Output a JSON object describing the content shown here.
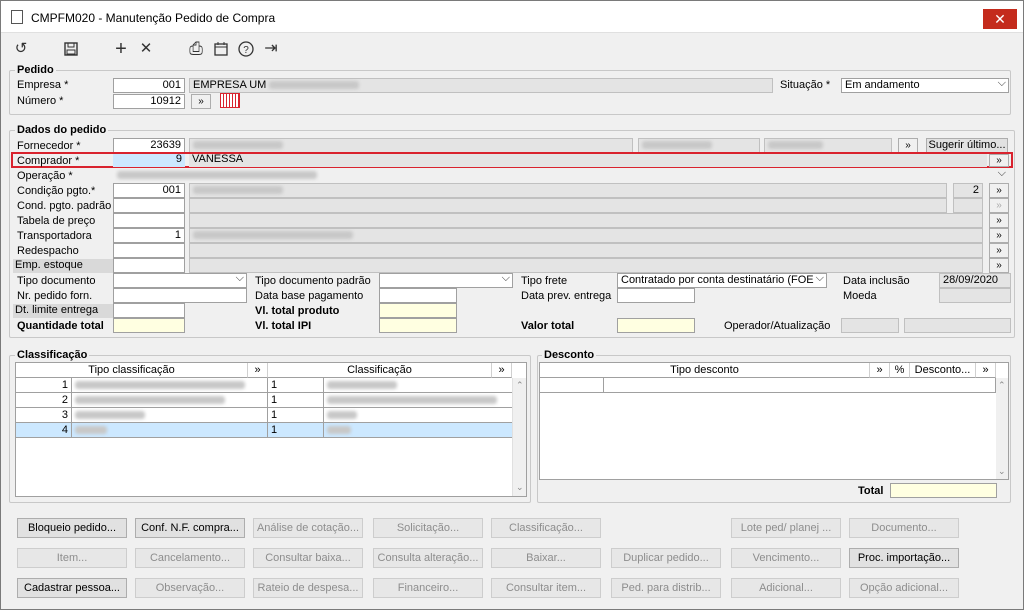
{
  "window": {
    "title": "CMPFM020 - Manutenção Pedido de Compra",
    "close": "✕"
  },
  "toolbar": {
    "undo": "↺",
    "save": "💾",
    "add": "+",
    "delete": "✕",
    "print": "⎙",
    "calendar": "📅",
    "help": "?",
    "exit": "⇥"
  },
  "pedido": {
    "title": "Pedido",
    "empresa_label": "Empresa *",
    "empresa_code": "001",
    "empresa_name": "EMPRESA UM",
    "numero_label": "Número *",
    "numero_value": "10912",
    "numero_btn": "»",
    "situacao_label": "Situação *",
    "situacao_value": "Em andamento"
  },
  "dados": {
    "title": "Dados do pedido",
    "fornecedor_label": "Fornecedor *",
    "fornecedor_code": "23639",
    "fornecedor_btn": "»",
    "sugerir": "Sugerir último...",
    "comprador_label": "Comprador *",
    "comprador_code": "9",
    "comprador_name": "VANESSA",
    "comprador_btn": "»",
    "operacao_label": "Operação *",
    "condicao_label": "Condição pgto.*",
    "condicao_code": "001",
    "condicao_num": "2",
    "condicao_btn": "»",
    "cond_padrao_label": "Cond. pgto. padrão",
    "tabela_label": "Tabela de preço",
    "tabela_btn": "»",
    "transp_label": "Transportadora",
    "transp_code": "1",
    "transp_btn": "»",
    "redesp_label": "Redespacho",
    "redesp_btn": "»",
    "emp_estoque_label": "Emp. estoque",
    "emp_estoque_btn": "»",
    "tipo_doc_label": "Tipo documento",
    "tipo_doc_padrao_label": "Tipo documento padrão",
    "tipo_frete_label": "Tipo frete",
    "tipo_frete_value": "Contratado por conta destinatário (FOE",
    "data_inclusao_label": "Data inclusão",
    "data_inclusao_value": "28/09/2020",
    "nr_pedido_label": "Nr. pedido forn.",
    "data_base_label": "Data base pagamento",
    "data_prev_label": "Data prev. entrega",
    "moeda_label": "Moeda",
    "dt_limite_label": "Dt. limite entrega",
    "vl_total_prod_label": "Vl. total produto",
    "qtd_total_label": "Quantidade total",
    "vl_total_ipi_label": "Vl. total IPI",
    "valor_total_label": "Valor total",
    "operador_label": "Operador/Atualização"
  },
  "classificacao": {
    "title": "Classificação",
    "col1": "Tipo classificação",
    "col_btn": "»",
    "col2": "Classificação",
    "col2_btn": "»",
    "rows": [
      {
        "n": "1",
        "c": "1"
      },
      {
        "n": "2",
        "c": "1"
      },
      {
        "n": "3",
        "c": "1"
      },
      {
        "n": "4",
        "c": "1"
      }
    ]
  },
  "desconto": {
    "title": "Desconto",
    "col1": "Tipo desconto",
    "btn1": "»",
    "pct": "%",
    "col2": "Desconto...",
    "btn2": "»",
    "total_label": "Total"
  },
  "buttons": {
    "row1": [
      {
        "label": "Bloqueio pedido...",
        "enabled": true
      },
      {
        "label": "Conf. N.F. compra...",
        "enabled": true
      },
      {
        "label": "Análise de cotação...",
        "enabled": false
      },
      {
        "label": "Solicitação...",
        "enabled": false
      },
      {
        "label": "Classificação...",
        "enabled": false
      },
      {
        "label": "Lote ped/ planej ...",
        "enabled": false
      },
      {
        "label": "Documento...",
        "enabled": false
      }
    ],
    "row2": [
      {
        "label": "Item...",
        "enabled": false
      },
      {
        "label": "Cancelamento...",
        "enabled": false
      },
      {
        "label": "Consultar baixa...",
        "enabled": false
      },
      {
        "label": "Consulta alteração...",
        "enabled": false
      },
      {
        "label": "Baixar...",
        "enabled": false
      },
      {
        "label": "Duplicar pedido...",
        "enabled": false
      },
      {
        "label": "Vencimento...",
        "enabled": false
      },
      {
        "label": "Proc. importação...",
        "enabled": true
      }
    ],
    "row3": [
      {
        "label": "Cadastrar pessoa...",
        "enabled": true
      },
      {
        "label": "Observação...",
        "enabled": false
      },
      {
        "label": "Rateio de despesa...",
        "enabled": false
      },
      {
        "label": "Financeiro...",
        "enabled": false
      },
      {
        "label": "Consultar item...",
        "enabled": false
      },
      {
        "label": "Ped. para distrib...",
        "enabled": false
      },
      {
        "label": "Adicional...",
        "enabled": false
      },
      {
        "label": "Opção adicional...",
        "enabled": false
      }
    ]
  },
  "colors": {
    "highlight": "#d9232e",
    "selection": "#cce8ff",
    "readonly": "#ffffe1"
  }
}
